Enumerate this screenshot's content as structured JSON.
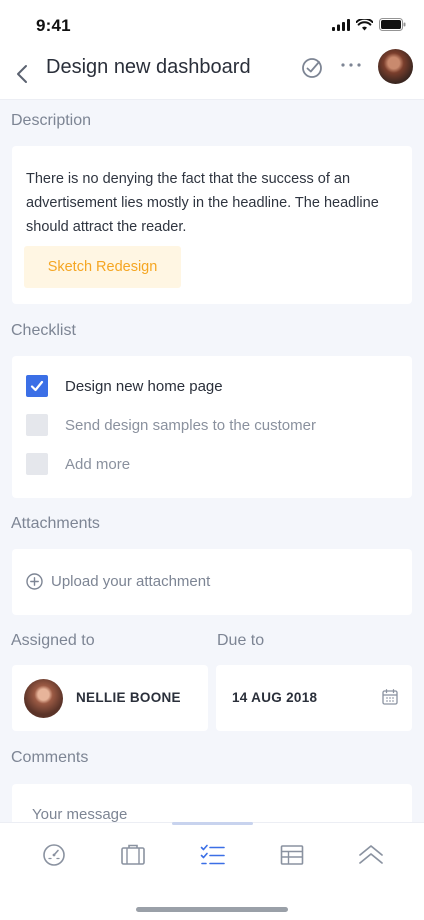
{
  "status_bar": {
    "time": "9:41"
  },
  "header": {
    "title": "Design new dashboard"
  },
  "description": {
    "label": "Description",
    "text": "There is no denying the fact that the success of an advertisement lies mostly in the headline. The headline should attract the reader.",
    "tag": "Sketch Redesign"
  },
  "checklist": {
    "label": "Checklist",
    "items": [
      {
        "label": "Design new home page",
        "checked": true
      },
      {
        "label": "Send design samples to the customer",
        "checked": false
      },
      {
        "label": "Add more",
        "checked": false
      }
    ]
  },
  "attachments": {
    "label": "Attachments",
    "upload_label": "Upload your attachment"
  },
  "assigned": {
    "label": "Assigned to",
    "name": "NELLIE BOONE"
  },
  "due": {
    "label": "Due to",
    "date": "14 AUG 2018"
  },
  "comments": {
    "label": "Comments",
    "placeholder": "Your message"
  },
  "tab_bar": {
    "tabs": [
      {
        "icon": "dashboard-icon",
        "active": false
      },
      {
        "icon": "briefcase-icon",
        "active": false
      },
      {
        "icon": "checklist-icon",
        "active": true
      },
      {
        "icon": "table-icon",
        "active": false
      },
      {
        "icon": "chevrons-up-icon",
        "active": false
      }
    ]
  },
  "colors": {
    "accent": "#3b6fe6",
    "tag_text": "#f5a623",
    "tag_bg": "#fff6e3",
    "icon_gray": "#8a92a0"
  }
}
